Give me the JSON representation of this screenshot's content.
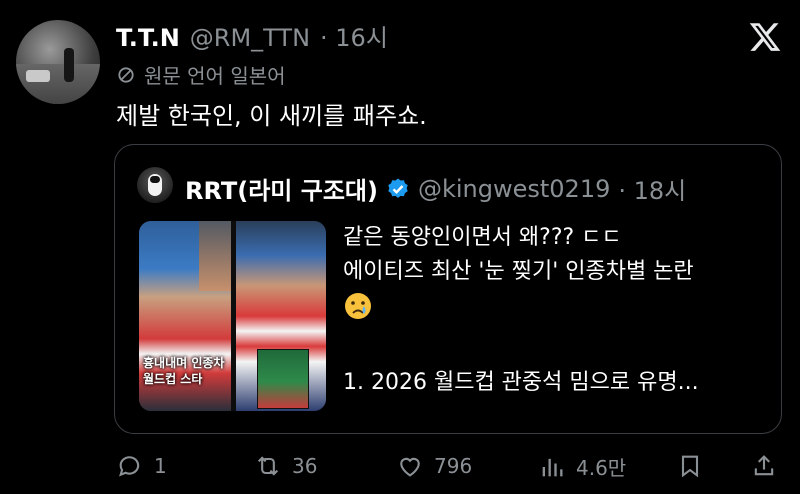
{
  "post": {
    "display_name": "T.T.N",
    "handle": "@RM_TTN",
    "time": "· 16시",
    "translation_note": "원문 언어 일본어",
    "text": "제발 한국인, 이 새끼를 패주쇼."
  },
  "quote": {
    "display_name": "RRT(라미 구조대)",
    "handle": "@kingwest0219",
    "time": "· 18시",
    "lines": [
      "같은 동양인이면서 왜??? ㄷㄷ",
      "에이티즈 최산 '눈 찢기' 인종차별 논란",
      "",
      "1. 2026 월드컵 관중석 밈으로 유명..."
    ],
    "emoji": "crying-face",
    "thumbnail_caption": [
      "흉내내며 인종차",
      "월드컵 스타"
    ]
  },
  "actions": {
    "replies": "1",
    "reposts": "36",
    "likes": "796",
    "views": "4.6만"
  },
  "colors": {
    "background": "#000000",
    "text_primary": "#e7e9ea",
    "text_secondary": "#8b9095",
    "verified_blue": "#1d9bf0",
    "quote_border": "#3a3e43"
  }
}
